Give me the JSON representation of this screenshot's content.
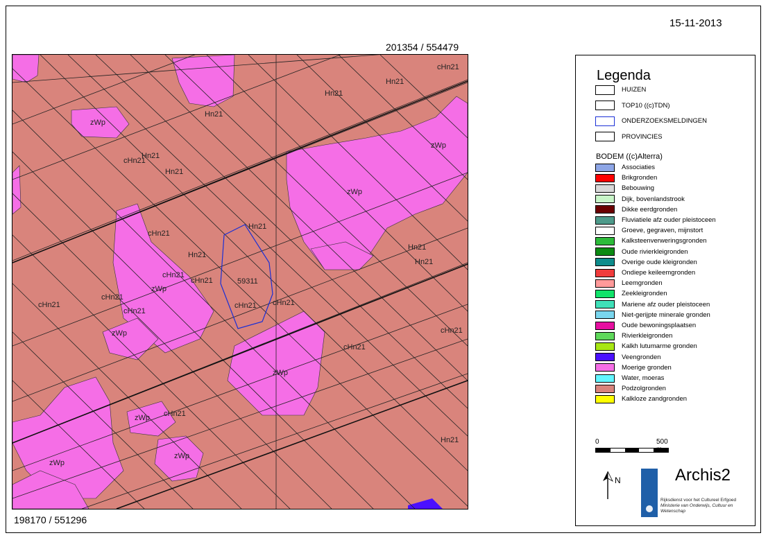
{
  "date": "15-11-2013",
  "coords": {
    "top_right": "201354 / 554479",
    "bottom_left": "198170 / 551296"
  },
  "map": {
    "soil_labels": [
      {
        "id": "chn-a",
        "text": "cHn21"
      },
      {
        "id": "hn-a",
        "text": "Hn21"
      },
      {
        "id": "hn-b",
        "text": "Hn21"
      },
      {
        "id": "zwp-a",
        "text": "zWp"
      },
      {
        "id": "hn-c",
        "text": "Hn21"
      },
      {
        "id": "zwp-b",
        "text": "zWp"
      },
      {
        "id": "chn-b",
        "text": "cHn21"
      },
      {
        "id": "hn-d",
        "text": "Hn21"
      },
      {
        "id": "zwp-c",
        "text": "zWp"
      },
      {
        "id": "hn-e",
        "text": "Hn21"
      },
      {
        "id": "hn-f",
        "text": "Hn21"
      },
      {
        "id": "hn-g",
        "text": "Hn21"
      },
      {
        "id": "chn-c",
        "text": "cHn21"
      },
      {
        "id": "chn-d",
        "text": "cHn21"
      },
      {
        "id": "zwp-d",
        "text": "zWp"
      },
      {
        "id": "num",
        "text": "59311"
      },
      {
        "id": "chn-e",
        "text": "cHn21"
      },
      {
        "id": "chn-f",
        "text": "cHn21"
      },
      {
        "id": "chn-g",
        "text": "cHn21"
      },
      {
        "id": "chn-h",
        "text": "cHn21"
      },
      {
        "id": "zwp-e",
        "text": "zWp"
      },
      {
        "id": "chn-i",
        "text": "cHn21"
      },
      {
        "id": "chn-j",
        "text": "cHn21"
      },
      {
        "id": "zwp-f",
        "text": "zWp"
      },
      {
        "id": "chn-k",
        "text": "cHn21"
      },
      {
        "id": "zwp-g",
        "text": "zWp"
      },
      {
        "id": "chn-l",
        "text": "cHn21"
      },
      {
        "id": "zwp-h",
        "text": "zWp"
      },
      {
        "id": "zwp-i",
        "text": "zWp"
      },
      {
        "id": "hn-h",
        "text": "Hn21"
      },
      {
        "id": "chn-m",
        "text": "cHn21"
      },
      {
        "id": "hn-i",
        "text": "Hn21"
      },
      {
        "id": "hn-j",
        "text": "Hn21"
      }
    ]
  },
  "legend": {
    "title": "Legenda",
    "layers": [
      {
        "label": "HUIZEN",
        "color": "#ffffff",
        "border": "#000000"
      },
      {
        "label": "TOP10 ((c)TDN)",
        "color": "#ffffff",
        "border": "#000000"
      },
      {
        "label": "ONDERZOEKSMELDINGEN",
        "color": "#ffffff",
        "border": "#1a2fd6"
      },
      {
        "label": "PROVINCIES",
        "color": "#ffffff",
        "border": "#000000"
      }
    ],
    "bodem_title": "BODEM ((c)Alterra)",
    "bodem": [
      {
        "label": "Associaties",
        "color": "#8ea6e6"
      },
      {
        "label": "Brikgronden",
        "color": "#ff0000"
      },
      {
        "label": "Bebouwing",
        "color": "#d9d9d9"
      },
      {
        "label": "Dijk, bovenlandstrook",
        "color": "#c8f5c8"
      },
      {
        "label": "Dikke eerdgronden",
        "color": "#6b0000"
      },
      {
        "label": "Fluviatiele afz ouder pleistoceen",
        "color": "#4e9a8a"
      },
      {
        "label": "Groeve, gegraven, mijnstort",
        "color": "#ffffff"
      },
      {
        "label": "Kalksteenverweringsgronden",
        "color": "#2dbb3a"
      },
      {
        "label": "Oude rivierkleigronden",
        "color": "#0c8a12"
      },
      {
        "label": "Overige oude kleigronden",
        "color": "#0e8c8c"
      },
      {
        "label": "Ondiepe keileemgronden",
        "color": "#f03c3c"
      },
      {
        "label": "Leemgronden",
        "color": "#ff9a9a"
      },
      {
        "label": "Zeekleigronden",
        "color": "#11e36a"
      },
      {
        "label": "Mariene afz ouder pleistoceen",
        "color": "#3fe0b8"
      },
      {
        "label": "Niet-gerijpte minerale gronden",
        "color": "#7ad6ee"
      },
      {
        "label": "Oude bewoningsplaatsen",
        "color": "#e60fa0"
      },
      {
        "label": "Rivierkleigronden",
        "color": "#5ed85a"
      },
      {
        "label": "Kalkh lutumarme gronden",
        "color": "#a8e614"
      },
      {
        "label": "Veengronden",
        "color": "#4a10ff"
      },
      {
        "label": "Moerige gronden",
        "color": "#f56ee6"
      },
      {
        "label": "Water, moeras",
        "color": "#62f6ff"
      },
      {
        "label": "Podzolgronden",
        "color": "#d9847c"
      },
      {
        "label": "Kalkloze zandgronden",
        "color": "#ffff00"
      }
    ],
    "scale": {
      "start": "0",
      "end": "500 m"
    },
    "north": "N",
    "app_name": "Archis2",
    "org_lines": [
      "Rijksdienst voor het Cultureel Erfgoed",
      "Ministerie van Onderwijs, Cultuur en",
      "Wetenschap"
    ]
  }
}
